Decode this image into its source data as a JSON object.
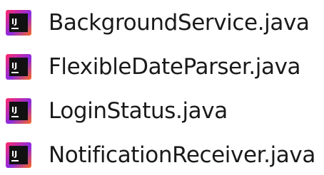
{
  "files": [
    {
      "name": "BackgroundService.java",
      "icon": "intellij-idea-file-icon"
    },
    {
      "name": "FlexibleDateParser.java",
      "icon": "intellij-idea-file-icon"
    },
    {
      "name": "LoginStatus.java",
      "icon": "intellij-idea-file-icon"
    },
    {
      "name": "NotificationReceiver.java",
      "icon": "intellij-idea-file-icon"
    }
  ],
  "icon_colors": {
    "outer_gradient_start": "#ff2a6a",
    "outer_gradient_mid": "#8a2be2",
    "outer_gradient_end": "#ff6a1a",
    "inner_background": "#111111",
    "inner_text": "#ffffff"
  }
}
